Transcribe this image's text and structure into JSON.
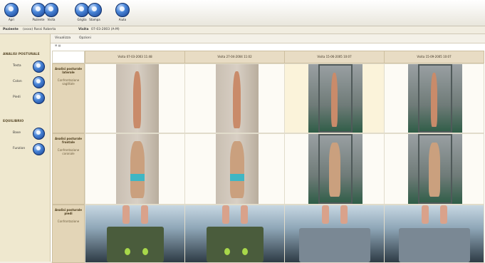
{
  "toolbar": {
    "buttons": [
      {
        "label": "Apri",
        "icon": "globe-icon"
      },
      {
        "label": "Paziente",
        "icon": "globe-icon"
      },
      {
        "label": "Visita",
        "icon": "globe-icon"
      },
      {
        "label": "Griglia",
        "icon": "globe-icon"
      },
      {
        "label": "Stampa",
        "icon": "globe-icon"
      },
      {
        "label": "Aiuto",
        "icon": "globe-icon"
      }
    ]
  },
  "infobar": {
    "patient_label": "Paziente",
    "patient_value": "(xxxx) Rossi Roberta",
    "visit_label": "Visita",
    "visit_value": "07-03-2003 (A-M)"
  },
  "sidebar": {
    "section1": "ANALISI POSTURALE",
    "items1": [
      "Testa",
      "Colon",
      "Piedi"
    ],
    "section2": "EQUILIBRIO",
    "items2": [
      "Base",
      "Funzion"
    ]
  },
  "tabs": [
    "Visualizza",
    "Opzioni"
  ],
  "subtool": "⊞ ▤",
  "columns": [
    "Visita 07-03-2003 11:48",
    "Visita 27-04-2004 11:02",
    "Visita 15-06-2005 10:07",
    "Visita 15-09-2005 10:07"
  ],
  "rows": [
    {
      "title": "Analisi posturale laterale",
      "subtitle": "Confrontazione sagittale"
    },
    {
      "title": "Analisi posturale frontale",
      "subtitle": "Confrontazione coronale"
    },
    {
      "title": "Analisi posturale piedi",
      "subtitle": "Confrontazione"
    }
  ]
}
